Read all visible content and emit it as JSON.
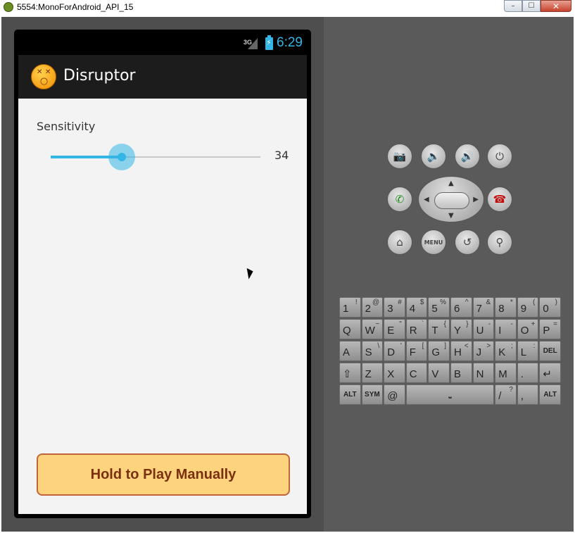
{
  "window": {
    "title": "5554:MonoForAndroid_API_15",
    "min": "–",
    "max": "☐",
    "close": "✕"
  },
  "status": {
    "network": "3G",
    "time": "6:29"
  },
  "app": {
    "title": "Disruptor"
  },
  "sensitivity": {
    "label": "Sensitivity",
    "value": 34,
    "display": "34",
    "max": 100
  },
  "play_button": {
    "label": "Hold to Play Manually"
  },
  "hw_buttons": {
    "menu_label": "MENU"
  },
  "keyboard": {
    "rows": [
      [
        [
          "1",
          "!"
        ],
        [
          "2",
          "@"
        ],
        [
          "3",
          "#"
        ],
        [
          "4",
          "$"
        ],
        [
          "5",
          "%"
        ],
        [
          "6",
          "^"
        ],
        [
          "7",
          "&"
        ],
        [
          "8",
          "*"
        ],
        [
          "9",
          "("
        ],
        [
          "0",
          ")"
        ]
      ],
      [
        [
          "Q",
          ""
        ],
        [
          "W",
          "~"
        ],
        [
          "E",
          "\""
        ],
        [
          "R",
          "`"
        ],
        [
          "T",
          "{"
        ],
        [
          "Y",
          "}"
        ],
        [
          "U",
          "-"
        ],
        [
          "I",
          "-"
        ],
        [
          "O",
          "+"
        ],
        [
          "P",
          "="
        ]
      ],
      [
        [
          "A",
          ""
        ],
        [
          "S",
          "\\"
        ],
        [
          "D",
          "'"
        ],
        [
          "F",
          "["
        ],
        [
          "G",
          "]"
        ],
        [
          "H",
          "<"
        ],
        [
          "J",
          ">"
        ],
        [
          "K",
          ";"
        ],
        [
          "L",
          ":"
        ],
        [
          "DEL",
          ""
        ]
      ],
      [
        [
          "⇧",
          ""
        ],
        [
          "Z",
          ""
        ],
        [
          "X",
          ""
        ],
        [
          "C",
          ""
        ],
        [
          "V",
          ""
        ],
        [
          "B",
          ""
        ],
        [
          "N",
          ""
        ],
        [
          "M",
          ""
        ],
        [
          ".",
          ""
        ],
        [
          "↵",
          ""
        ]
      ],
      [
        [
          "ALT",
          ""
        ],
        [
          "SYM",
          ""
        ],
        [
          "@",
          ""
        ],
        [
          "SPACE",
          ""
        ],
        [
          "/",
          "?"
        ],
        [
          ",",
          ""
        ],
        [
          "ALT",
          ""
        ]
      ]
    ]
  },
  "colors": {
    "accent": "#33b5e5",
    "button_fill": "#fdd37e",
    "button_border": "#c4633a"
  }
}
